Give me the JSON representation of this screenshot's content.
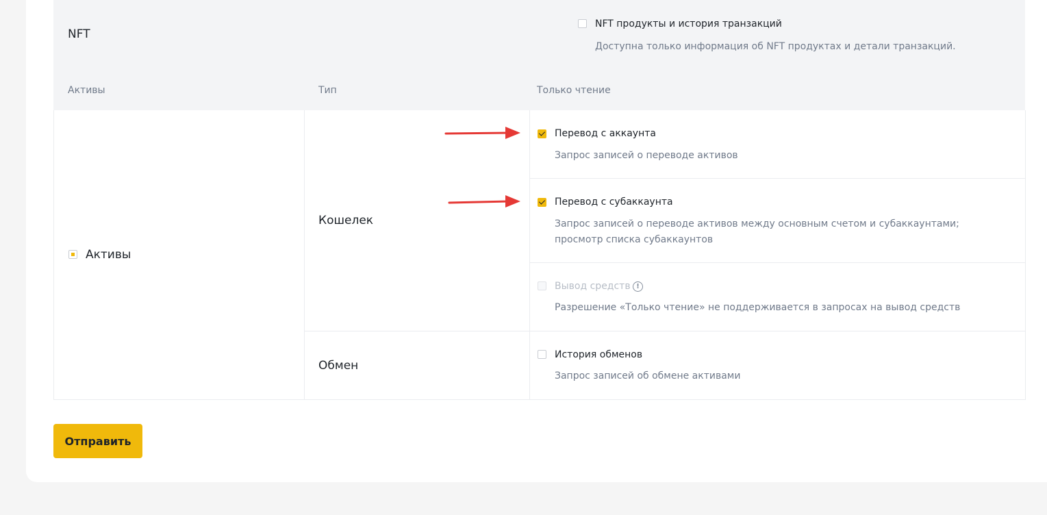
{
  "nft": {
    "title": "NFT",
    "option_label": "NFT продукты и история транзакций",
    "option_desc": "Доступна только информация об NFT продуктах и детали транзакций.",
    "checked": false
  },
  "headers": {
    "assets": "Активы",
    "type": "Тип",
    "readonly": "Только чтение"
  },
  "assets_group": {
    "label": "Активы",
    "state": "partial"
  },
  "types": {
    "wallet": "Кошелек",
    "exchange": "Обмен"
  },
  "options": {
    "account_transfer": {
      "label": "Перевод с аккаунта",
      "desc": "Запрос записей о переводе активов",
      "checked": true
    },
    "subaccount_transfer": {
      "label": "Перевод с субаккаунта",
      "desc": "Запрос записей о переводе активов между основным счетом и субаккаунтами; просмотр списка субаккаунтов",
      "checked": true
    },
    "withdrawal": {
      "label": "Вывод средств",
      "desc": "Разрешение «Только чтение» не поддерживается в запросах на вывод средств",
      "disabled": true,
      "info_icon": "info-icon"
    },
    "exchange_history": {
      "label": "История обменов",
      "desc": "Запрос записей об обмене активами",
      "checked": false
    }
  },
  "submit_label": "Отправить",
  "colors": {
    "accent": "#f0b90b",
    "arrow": "#e53935"
  }
}
